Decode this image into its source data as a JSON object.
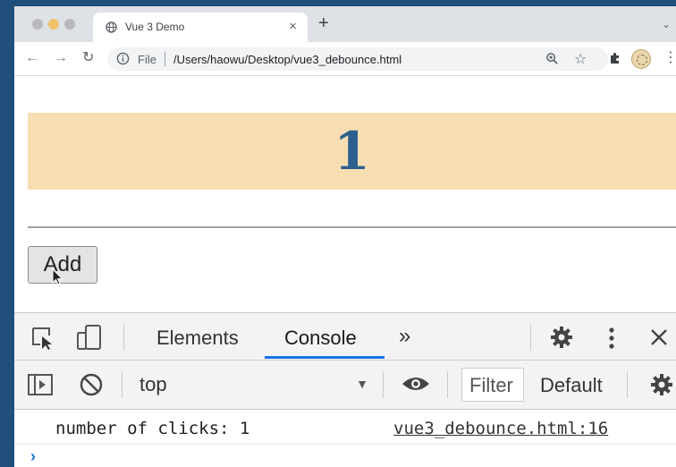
{
  "browser": {
    "tab": {
      "title": "Vue 3 Demo",
      "close": "×",
      "favicon": "globe-icon"
    },
    "new_tab": "+",
    "tab_search": "⌄",
    "nav": {
      "back": "←",
      "forward": "→",
      "reload": "↻"
    },
    "omnibox": {
      "scheme": "File",
      "url": "/Users/haowu/Desktop/vue3_debounce.html",
      "star": "☆"
    },
    "menu": "⋮"
  },
  "page": {
    "counter": "1",
    "add_label": "Add",
    "colors": {
      "banner": "#f7deb2",
      "counter": "#2c5f8f"
    }
  },
  "devtools": {
    "tabs": [
      {
        "label": "Elements"
      },
      {
        "label": "Console",
        "active": true
      }
    ],
    "more": "»",
    "context": "top",
    "filter": "Filter",
    "levels": "Default",
    "console": [
      {
        "message": "number of clicks: 1",
        "source": "vue3_debounce.html:16"
      }
    ],
    "prompt": "›"
  }
}
